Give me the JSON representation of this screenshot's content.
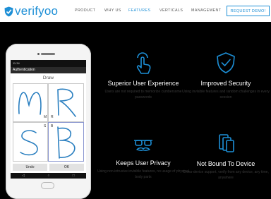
{
  "brand": {
    "logo_text": "verifyoo",
    "accent": "#1d8fd6"
  },
  "nav": {
    "items": [
      {
        "label": "PRODUCT",
        "active": false
      },
      {
        "label": "WHY US",
        "active": false
      },
      {
        "label": "FEATURES",
        "active": true
      },
      {
        "label": "VERTICALS",
        "active": false
      },
      {
        "label": "MANAGEMENT",
        "active": false
      }
    ],
    "cta_label": "REQUEST DEMO!"
  },
  "phone": {
    "status_text": "11:34",
    "app_title": "Authentication",
    "draw_label": "Draw",
    "cells": [
      {
        "big": "M",
        "small": "M"
      },
      {
        "big": "R",
        "small": "R"
      },
      {
        "big": "S",
        "small": "S"
      },
      {
        "big": "B",
        "small": "B"
      }
    ],
    "buttons": {
      "undo": "Undo",
      "ok": "OK"
    }
  },
  "features": [
    {
      "icon": "tap-hand-icon",
      "title": "Superior User Experience",
      "description": "Users are not required to memorize cumbersome passwords"
    },
    {
      "icon": "shield-check-icon",
      "title": "Improved Security",
      "description": "Using invisible features and random challenges in every session"
    },
    {
      "icon": "glasses-mustache-icon",
      "title": "Keeps User Privacy",
      "description": "Using non-intrusive invisible features, no usage of physical body parts"
    },
    {
      "icon": "devices-icon",
      "title": "Not Bound To Device",
      "description": "Cross-device support, verify from any device, any time, anywhere"
    }
  ]
}
